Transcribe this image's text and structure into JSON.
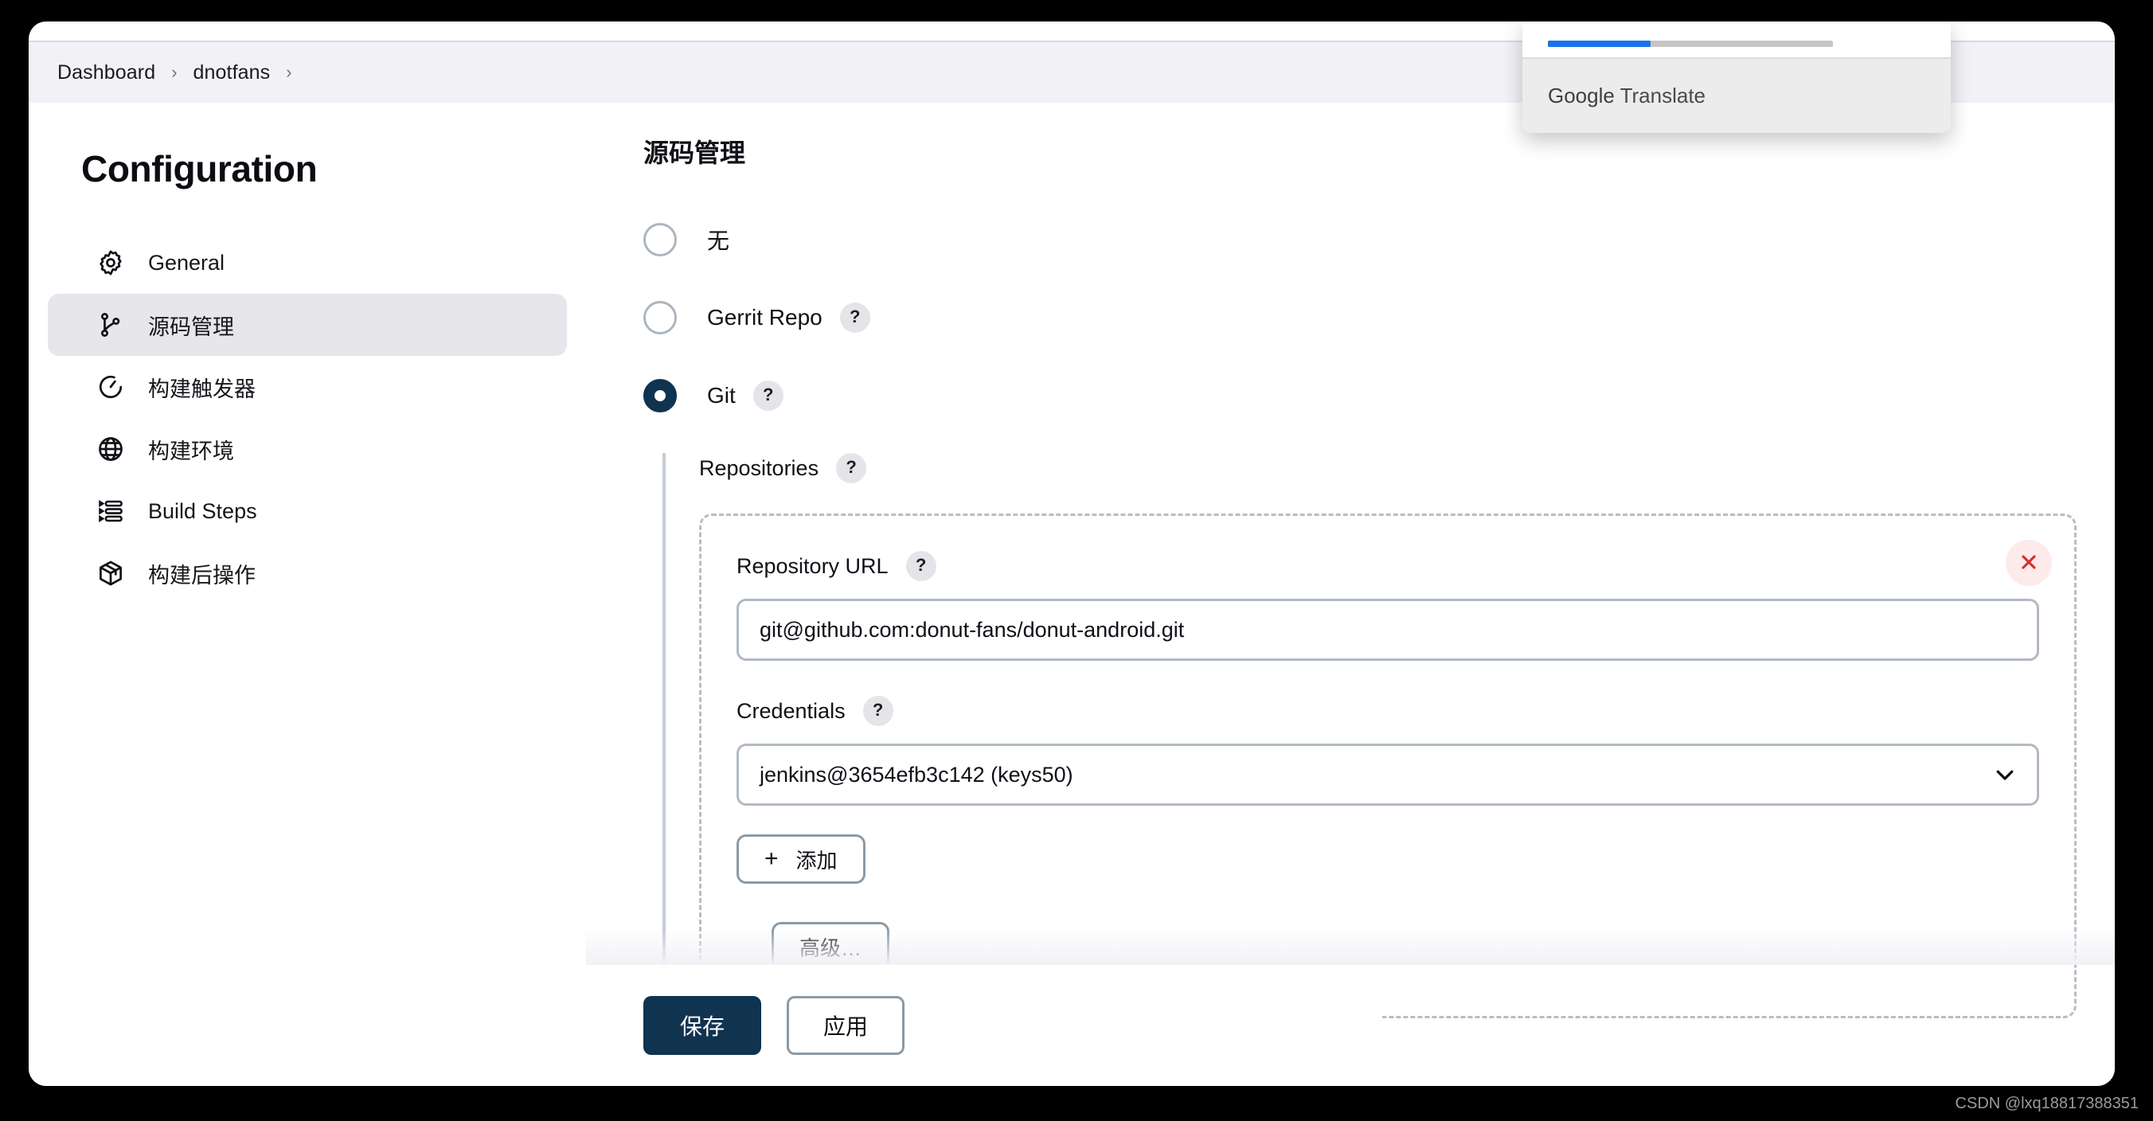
{
  "breadcrumb": {
    "items": [
      "Dashboard",
      "dnotfans"
    ],
    "separator": "›"
  },
  "sidebar": {
    "title": "Configuration",
    "items": [
      {
        "label": "General",
        "icon": "gear-icon",
        "active": false
      },
      {
        "label": "源码管理",
        "icon": "source-branch-icon",
        "active": true
      },
      {
        "label": "构建触发器",
        "icon": "clock-icon",
        "active": false
      },
      {
        "label": "构建环境",
        "icon": "globe-icon",
        "active": false
      },
      {
        "label": "Build Steps",
        "icon": "list-steps-icon",
        "active": false
      },
      {
        "label": "构建后操作",
        "icon": "package-icon",
        "active": false
      }
    ]
  },
  "main": {
    "section_title": "源码管理",
    "scm_options": [
      {
        "label": "无",
        "selected": false,
        "help": false
      },
      {
        "label": "Gerrit Repo",
        "selected": false,
        "help": true
      },
      {
        "label": "Git",
        "selected": true,
        "help": true
      }
    ],
    "help_glyph": "?",
    "git": {
      "repositories_label": "Repositories",
      "repository_url_label": "Repository URL",
      "repository_url_value": "git@github.com:donut-fans/donut-android.git",
      "repository_url_placeholder": "",
      "credentials_label": "Credentials",
      "credentials_value": "jenkins@3654efb3c142 (keys50)",
      "add_button_label": "添加",
      "add_button_plus": "+",
      "advanced_button_label": "高级…",
      "remove_icon": "close-icon",
      "dropdown_icon": "chevron-down-icon"
    }
  },
  "footer": {
    "save_label": "保存",
    "apply_label": "应用"
  },
  "translate_popup": {
    "brand_strong": "Google",
    "brand_rest": " Translate",
    "progress_percent": 36
  },
  "watermark": "CSDN @lxq18817388351",
  "colors": {
    "accent_navy": "#103350",
    "header_bg": "#f1f1f6",
    "active_nav_bg": "#e6e6eb",
    "progress_blue": "#1a73e8",
    "remove_red": "#d32f2f",
    "remove_bg": "#fdeaea"
  }
}
